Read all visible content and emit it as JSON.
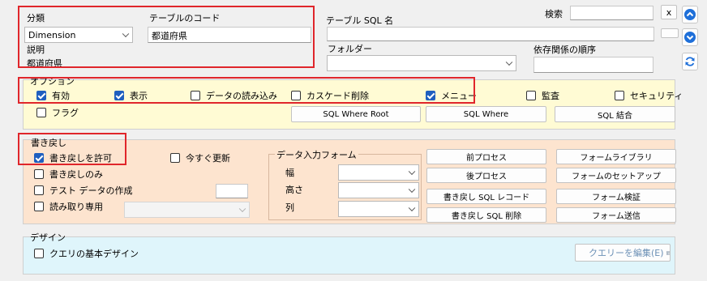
{
  "header": {
    "category_label": "分類",
    "category_value": "Dimension",
    "table_code_label": "テーブルのコード",
    "table_code_value": "都道府県",
    "description_label": "説明",
    "description_value": "都道府県",
    "table_sql_label": "テーブル SQL 名",
    "table_sql_value": "",
    "folder_label": "フォルダー",
    "folder_value": "",
    "search_label": "検索",
    "search_value": "",
    "search_clear": "x",
    "dependency_label": "依存関係の順序",
    "dependency_value": ""
  },
  "options": {
    "legend": "オプション",
    "items": [
      {
        "label": "有効",
        "checked": true
      },
      {
        "label": "表示",
        "checked": true
      },
      {
        "label": "データの読み込み",
        "checked": false
      },
      {
        "label": "カスケード削除",
        "checked": false
      },
      {
        "label": "メニュー",
        "checked": true
      },
      {
        "label": "監査",
        "checked": false
      },
      {
        "label": "セキュリティ",
        "checked": false
      },
      {
        "label": "フラグ",
        "checked": false
      }
    ],
    "buttons": [
      "SQL Where Root",
      "SQL Where",
      "SQL 結合"
    ]
  },
  "writeback": {
    "legend": "書き戻し",
    "checkboxes": [
      {
        "label": "書き戻しを許可",
        "checked": true
      },
      {
        "label": "今すぐ更新",
        "checked": false
      },
      {
        "label": "書き戻しのみ",
        "checked": false
      },
      {
        "label": "テスト データの作成",
        "checked": false
      },
      {
        "label": "読み取り専用",
        "checked": false
      }
    ],
    "data_entry_form": {
      "legend": "データ入力フォーム",
      "width_label": "幅",
      "height_label": "高さ",
      "column_label": "列"
    },
    "buttons_left": [
      "前プロセス",
      "後プロセス",
      "書き戻し SQL レコード",
      "書き戻し SQL 削除"
    ],
    "buttons_right": [
      "フォームライブラリ",
      "フォームのセットアップ",
      "フォーム検証",
      "フォーム送信"
    ]
  },
  "design": {
    "legend": "デザイン",
    "query_design_label": "クエリの基本デザイン",
    "query_design_checked": false,
    "edit_query_label": "クエリーを編集(E)"
  },
  "colors": {
    "options_bg": "#fffbd4",
    "writeback_bg": "#fde4cf",
    "design_bg": "#dff5fb",
    "highlight": "#e0262b",
    "check_blue": "#1f5fbf",
    "nav_blue": "#1e6fd9"
  },
  "icons": [
    "chevron-up-icon",
    "chevron-down-icon",
    "refresh-icon",
    "clear-icon"
  ]
}
